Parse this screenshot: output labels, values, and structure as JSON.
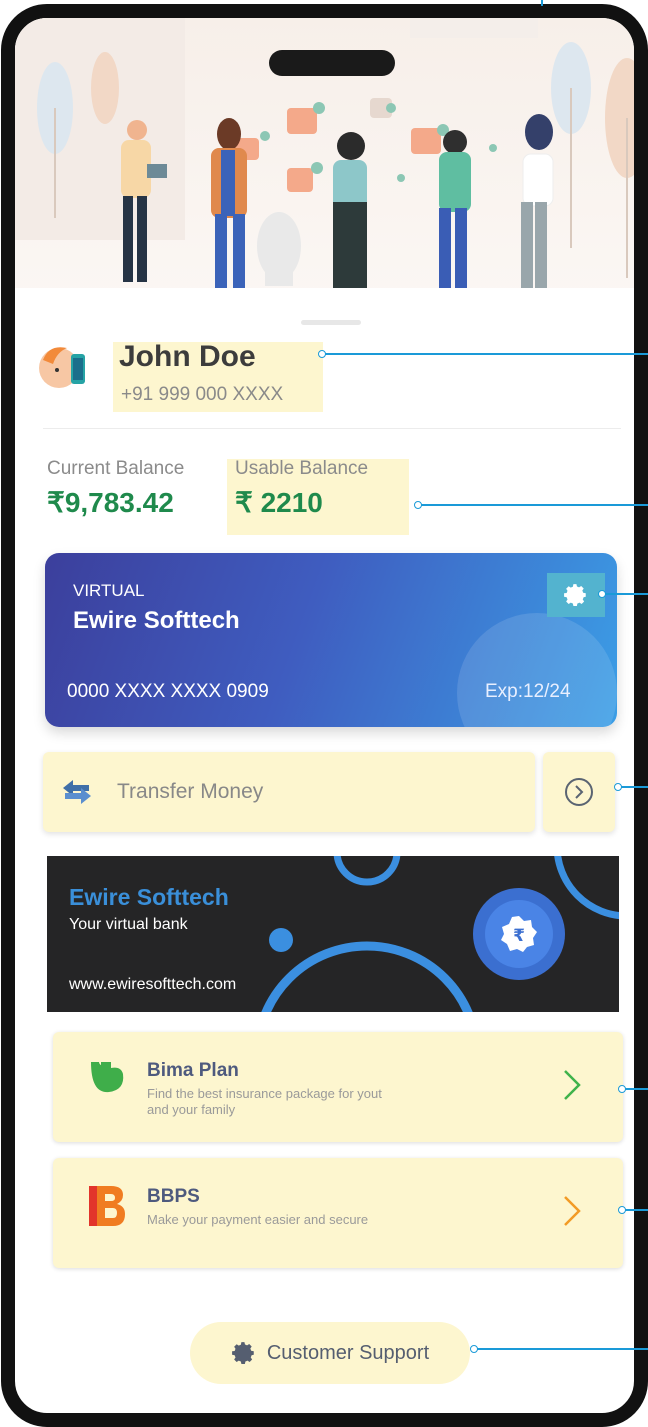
{
  "profile": {
    "name": "John Doe",
    "phone": "+91 999 000 XXXX"
  },
  "balances": {
    "current_label": "Current Balance",
    "current_value": "₹9,783.42",
    "usable_label": "Usable Balance",
    "usable_value": "₹ 2210"
  },
  "card": {
    "type": "VIRTUAL",
    "holder": "Ewire Softtech",
    "number": "0000 XXXX XXXX 0909",
    "expiry": "Exp:12/24"
  },
  "transfer": {
    "label": "Transfer Money"
  },
  "banner": {
    "brand": "Ewire Softtech",
    "tagline": "Your virtual bank",
    "url": "www.ewiresofttech.com"
  },
  "services": [
    {
      "title": "Bima Plan",
      "description": "Find the best insurance package for yout and your family",
      "icon": "bima-plan-logo",
      "chevron_color": "#3fb24b"
    },
    {
      "title": "BBPS",
      "description": "Make your payment easier and secure",
      "icon": "bbps-logo",
      "chevron_color": "#f29b26"
    }
  ],
  "support": {
    "label": "Customer Support"
  },
  "colors": {
    "accent_green": "#1f8a4c",
    "highlight": "#fdf6cf",
    "callout": "#1a9ad8",
    "card_gradient_start": "#3c3f9c",
    "card_gradient_end": "#3b9ee6"
  }
}
